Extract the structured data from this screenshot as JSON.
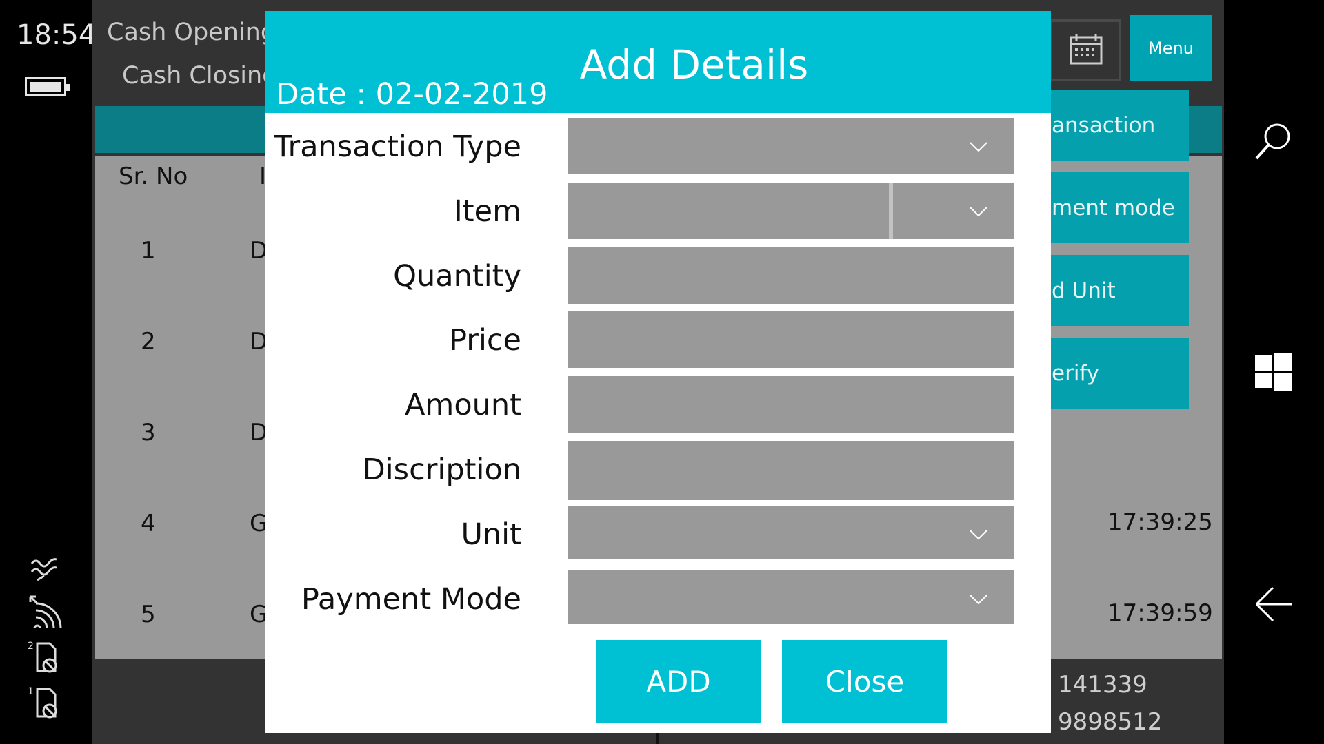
{
  "status_bar": {
    "time": "18:54"
  },
  "app": {
    "header_links": [
      "Cash Opening",
      "Cash Closing"
    ],
    "menu_label": "Menu",
    "table": {
      "col_sr": "Sr. No",
      "col_second_partial": "I",
      "rows": [
        {
          "sr": "1",
          "col2": "D",
          "time": ""
        },
        {
          "sr": "2",
          "col2": "D",
          "time": ""
        },
        {
          "sr": "3",
          "col2": "D",
          "time": ""
        },
        {
          "sr": "4",
          "col2": "G",
          "time": "17:39:25"
        },
        {
          "sr": "5",
          "col2": "G",
          "time": "17:39:59"
        }
      ]
    },
    "side_buttons": [
      "ansaction",
      "ment mode",
      "d Unit",
      "erify"
    ],
    "footer_numbers": [
      "141339",
      "9898512"
    ]
  },
  "dialog": {
    "title": "Add Details",
    "date": "Date : 02-02-2019",
    "fields": [
      {
        "label": "Transaction Type",
        "type": "dropdown",
        "value": ""
      },
      {
        "label": "Item",
        "type": "combo",
        "value": ""
      },
      {
        "label": "Quantity",
        "type": "text",
        "value": ""
      },
      {
        "label": "Price",
        "type": "text",
        "value": ""
      },
      {
        "label": "Amount",
        "type": "text",
        "value": ""
      },
      {
        "label": "Discription",
        "type": "text",
        "value": ""
      },
      {
        "label": "Unit",
        "type": "dropdown",
        "value": ""
      },
      {
        "label": "Payment Mode",
        "type": "dropdown",
        "value": ""
      }
    ],
    "add_label": "ADD",
    "close_label": "Close"
  },
  "colors": {
    "accent": "#00c0d4",
    "dark_teal": "#0b7d87",
    "field_bg": "#999999"
  }
}
